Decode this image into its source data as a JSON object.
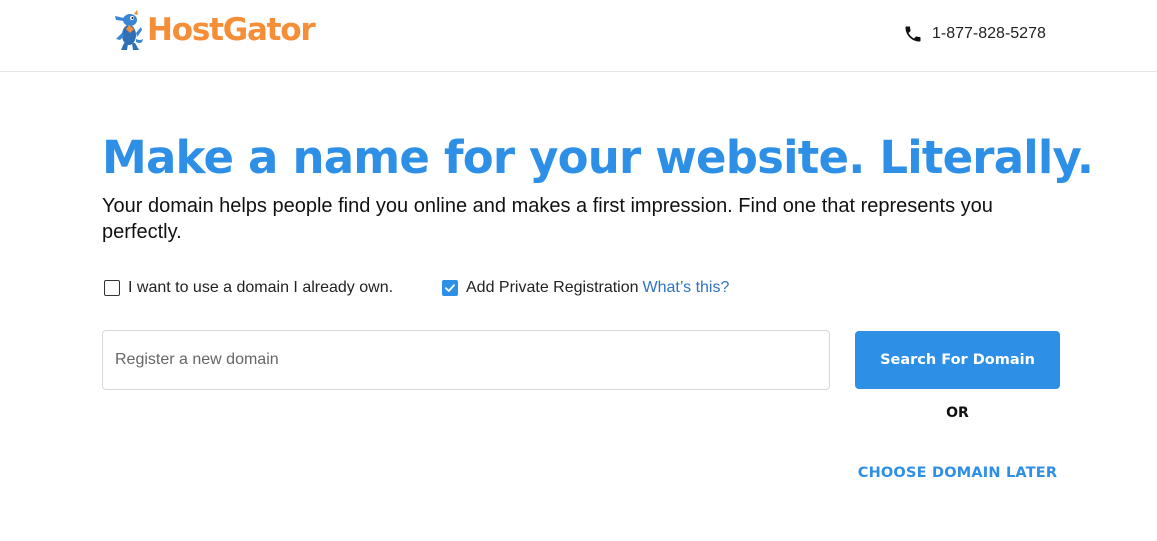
{
  "header": {
    "logo_text": "HostGator",
    "phone": "1-877-828-5278"
  },
  "hero": {
    "headline": "Make a name for your website. Literally.",
    "subhead": "Your domain helps people find you online and makes a first impression. Find one that represents you perfectly."
  },
  "options": {
    "own_domain": {
      "label": "I want to use a domain I already own.",
      "checked": false
    },
    "private_registration": {
      "label": "Add Private Registration",
      "checked": true,
      "help_link": "What’s this?"
    }
  },
  "search": {
    "placeholder": "Register a new domain",
    "button_label": "Search For Domain",
    "or_label": "OR",
    "later_link": "CHOOSE DOMAIN LATER"
  },
  "colors": {
    "brand_orange": "#f68d37",
    "accent_blue": "#2d8fe5",
    "link_blue": "#2f74c0"
  },
  "icons": {
    "logo": "gator-mascot-icon",
    "phone": "phone-icon",
    "checkmark": "check-icon"
  }
}
